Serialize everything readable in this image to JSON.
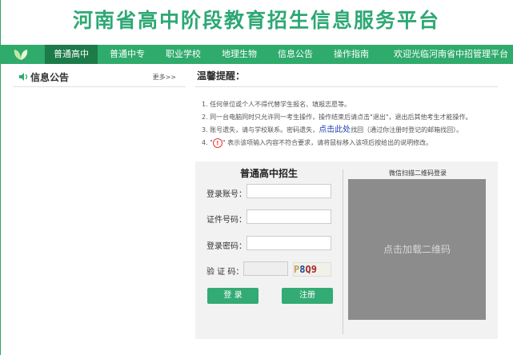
{
  "site": {
    "title": "河南省高中阶段教育招生信息服务平台"
  },
  "nav": {
    "items": [
      "普通高中",
      "普通中专",
      "职业学校",
      "地理生物",
      "信息公告",
      "操作指南"
    ],
    "active_index": 0,
    "welcome": "欢迎光临河南省中招管理平台"
  },
  "announcements": {
    "title": "信息公告",
    "more": "更多>>"
  },
  "reminder": {
    "title": "温馨提醒：",
    "items": [
      "1. 任何单位或个人不得代替学生报名、填报志愿等。",
      "2. 同一台电脑同时只允许同一考生操作，操作结束后请点击\"退出\"，退出后其他考生才能操作。",
      "3. 账号遗失，请与学校联系。密码遗失，",
      "4. \""
    ],
    "item3_link": "点击此处",
    "item3_suffix": "找回（通过你注册时登记的邮箱找回）。",
    "item4_icon": "!",
    "item4_suffix": "\" 表示该项输入内容不符合要求，请将鼠标移入该项后按给出的说明修改。"
  },
  "login": {
    "title": "普通高中招生",
    "account_label": "登录账号：",
    "id_label": "证件号码：",
    "password_label": "登录密码：",
    "captcha_label": "验 证 码：",
    "captcha_text": [
      "P",
      "8",
      "Q9"
    ],
    "login_button": "登 录",
    "register_button": "注册"
  },
  "qr": {
    "title": "微信扫描二维码登录",
    "placeholder": "点击加载二维码"
  },
  "colors": {
    "brand": "#2fab6c",
    "nav_active": "#1c7b49",
    "title": "#2ea874",
    "link": "#1f3fb7",
    "warning": "#ee3333"
  }
}
